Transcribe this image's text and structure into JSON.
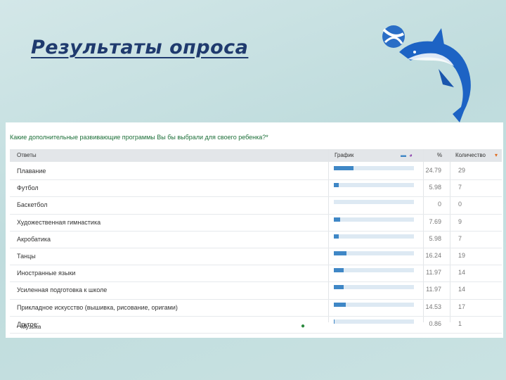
{
  "slide": {
    "title": "Результаты опроса"
  },
  "survey": {
    "question": "Какие дополнительные развивающие программы Вы бы выбрали для своего ребенка?*",
    "columns": {
      "answers": "Ответы",
      "chart": "График",
      "percent": "%",
      "count": "Количество"
    },
    "rows": [
      {
        "label": "Плавание",
        "percent": "24.79",
        "count": "29",
        "fraction": 0.248
      },
      {
        "label": "Футбол",
        "percent": "5.98",
        "count": "7",
        "fraction": 0.06
      },
      {
        "label": "Баскетбол",
        "percent": "0",
        "count": "0",
        "fraction": 0
      },
      {
        "label": "Художественная гимнастика",
        "percent": "7.69",
        "count": "9",
        "fraction": 0.077
      },
      {
        "label": "Акробатика",
        "percent": "5.98",
        "count": "7",
        "fraction": 0.06
      },
      {
        "label": "Танцы",
        "percent": "16.24",
        "count": "19",
        "fraction": 0.162
      },
      {
        "label": "Иностранные языки",
        "percent": "11.97",
        "count": "14",
        "fraction": 0.12
      },
      {
        "label": "Усиленная подготовка к школе",
        "percent": "11.97",
        "count": "14",
        "fraction": 0.12
      },
      {
        "label": "Прикладное искусство (вышивка, рисование, оригами)",
        "percent": "14.53",
        "count": "17",
        "fraction": 0.145
      },
      {
        "label": "Другое:",
        "percent": "0.86",
        "count": "1",
        "fraction": 0.009
      }
    ],
    "other_answer": "Музыка",
    "colors": {
      "bar": "#3f87c6",
      "track": "#dde9f3",
      "question": "#1c6f38"
    }
  }
}
